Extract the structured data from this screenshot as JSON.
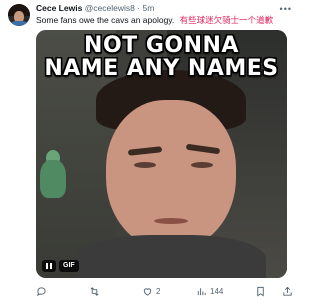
{
  "tweet": {
    "author": {
      "name": "Cece Lewis",
      "handle": "@cecelewis8",
      "separator": "·",
      "time": "5m"
    },
    "text": "Some fans owe the cavs an apology.",
    "translation": "有些球迷欠骑士一个道歉",
    "media": {
      "caption_line1": "NOT GONNA",
      "caption_line2": "NAME ANY NAMES",
      "badge": "GIF"
    },
    "actions": {
      "reply": {
        "icon": "reply-icon",
        "count": ""
      },
      "retweet": {
        "icon": "retweet-icon",
        "count": ""
      },
      "like": {
        "icon": "heart-icon",
        "count": "2"
      },
      "views": {
        "icon": "views-icon",
        "count": "144"
      },
      "bookmark": {
        "icon": "bookmark-icon"
      },
      "share": {
        "icon": "share-icon"
      }
    },
    "colors": {
      "text": "#0f1419",
      "muted": "#536471",
      "translation": "#e0245e"
    }
  }
}
